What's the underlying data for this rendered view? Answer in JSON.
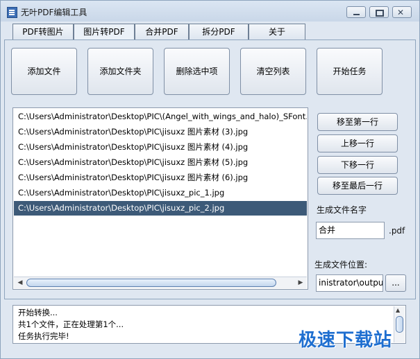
{
  "window": {
    "title": "无叶PDF编辑工具",
    "close_glyph": "✕"
  },
  "tabs": [
    {
      "label": "PDF转图片"
    },
    {
      "label": "图片转PDF"
    },
    {
      "label": "合并PDF"
    },
    {
      "label": "拆分PDF"
    },
    {
      "label": "关于"
    }
  ],
  "actions": {
    "add_file": "添加文件",
    "add_folder": "添加文件夹",
    "delete_selected": "删除选中项",
    "clear_list": "清空列表",
    "start_task": "开始任务"
  },
  "file_list": {
    "items": [
      "C:\\Users\\Administrator\\Desktop\\PIC\\(Angel_with_wings_and_halo)_SFont.C",
      "C:\\Users\\Administrator\\Desktop\\PIC\\jisuxz 图片素材 (3).jpg",
      "C:\\Users\\Administrator\\Desktop\\PIC\\jisuxz 图片素材 (4).jpg",
      "C:\\Users\\Administrator\\Desktop\\PIC\\jisuxz 图片素材 (5).jpg",
      "C:\\Users\\Administrator\\Desktop\\PIC\\jisuxz 图片素材 (6).jpg",
      "C:\\Users\\Administrator\\Desktop\\PIC\\jisuxz_pic_1.jpg",
      "C:\\Users\\Administrator\\Desktop\\PIC\\jisuxz_pic_2.jpg"
    ],
    "selected_index": 6
  },
  "side": {
    "move_top": "移至第一行",
    "move_up": "上移一行",
    "move_down": "下移一行",
    "move_bottom": "移至最后一行",
    "filename_label": "生成文件名字",
    "filename_value": "合并",
    "ext_label": ".pdf",
    "location_label": "生成文件位置:",
    "location_value": "inistrator\\output",
    "browse_label": "..."
  },
  "log": {
    "lines": [
      "开始转换...",
      "共1个文件，正在处理第1个...",
      "任务执行完毕!"
    ]
  },
  "watermark": "极速下载站",
  "colors": {
    "selected_row": "#3d5a78",
    "window_bg": "#dfe7f1",
    "watermark": "#1f6fd0"
  }
}
